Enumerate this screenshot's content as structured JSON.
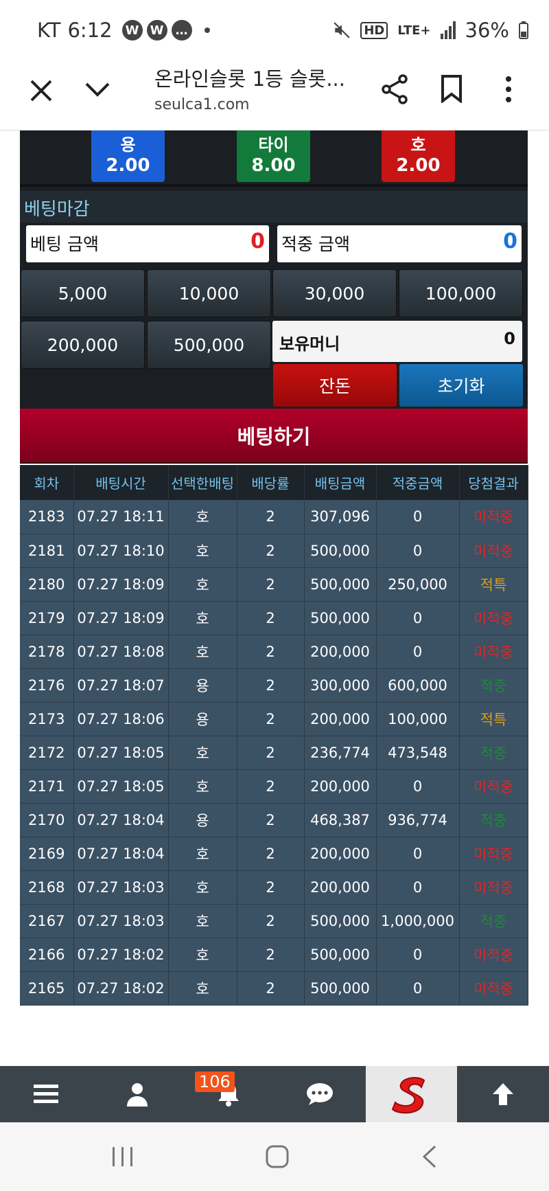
{
  "status": {
    "carrier": "KT",
    "time": "6:12",
    "network": "LTE+",
    "battery": "36%"
  },
  "browser": {
    "title": "온라인슬롯 1등 슬롯...",
    "domain": "seulca1.com"
  },
  "odds": [
    {
      "label": "용",
      "value": "2.00",
      "color": "#1b5fd6"
    },
    {
      "label": "타이",
      "value": "8.00",
      "color": "#127a3a"
    },
    {
      "label": "호",
      "value": "2.00",
      "color": "#c81414"
    }
  ],
  "betting": {
    "section_title": "베팅마감",
    "bet_amount_label": "베팅 금액",
    "bet_amount_value": "0",
    "win_amount_label": "적중 금액",
    "win_amount_value": "0",
    "chips": [
      "5,000",
      "10,000",
      "30,000",
      "100,000",
      "200,000",
      "500,000"
    ],
    "holdings_label": "보유머니",
    "holdings_value": "0",
    "balance_button": "잔돈",
    "reset_button": "초기화",
    "bet_button": "베팅하기"
  },
  "history": {
    "columns": [
      "회차",
      "배팅시간",
      "선택한배팅",
      "배당률",
      "배팅금액",
      "적중금액",
      "당첨결과"
    ],
    "rows": [
      [
        "2183",
        "07.27 18:11",
        "호",
        "2",
        "307,096",
        "0",
        "미적중"
      ],
      [
        "2181",
        "07.27 18:10",
        "호",
        "2",
        "500,000",
        "0",
        "미적중"
      ],
      [
        "2180",
        "07.27 18:09",
        "호",
        "2",
        "500,000",
        "250,000",
        "적특"
      ],
      [
        "2179",
        "07.27 18:09",
        "호",
        "2",
        "500,000",
        "0",
        "미적중"
      ],
      [
        "2178",
        "07.27 18:08",
        "호",
        "2",
        "200,000",
        "0",
        "미적중"
      ],
      [
        "2176",
        "07.27 18:07",
        "용",
        "2",
        "300,000",
        "600,000",
        "적중"
      ],
      [
        "2173",
        "07.27 18:06",
        "용",
        "2",
        "200,000",
        "100,000",
        "적특"
      ],
      [
        "2172",
        "07.27 18:05",
        "호",
        "2",
        "236,774",
        "473,548",
        "적중"
      ],
      [
        "2171",
        "07.27 18:05",
        "호",
        "2",
        "200,000",
        "0",
        "미적중"
      ],
      [
        "2170",
        "07.27 18:04",
        "용",
        "2",
        "468,387",
        "936,774",
        "적중"
      ],
      [
        "2169",
        "07.27 18:04",
        "호",
        "2",
        "200,000",
        "0",
        "미적중"
      ],
      [
        "2168",
        "07.27 18:03",
        "호",
        "2",
        "200,000",
        "0",
        "미적중"
      ],
      [
        "2167",
        "07.27 18:03",
        "호",
        "2",
        "500,000",
        "1,000,000",
        "적중"
      ],
      [
        "2166",
        "07.27 18:02",
        "호",
        "2",
        "500,000",
        "0",
        "미적중"
      ],
      [
        "2165",
        "07.27 18:02",
        "호",
        "2",
        "500,000",
        "0",
        "미적중"
      ]
    ]
  },
  "tabbar": {
    "notification_count": "106",
    "icons": [
      "menu-icon",
      "user-icon",
      "bell-icon",
      "chat-icon",
      "site-logo",
      "arrow-up-icon"
    ]
  }
}
